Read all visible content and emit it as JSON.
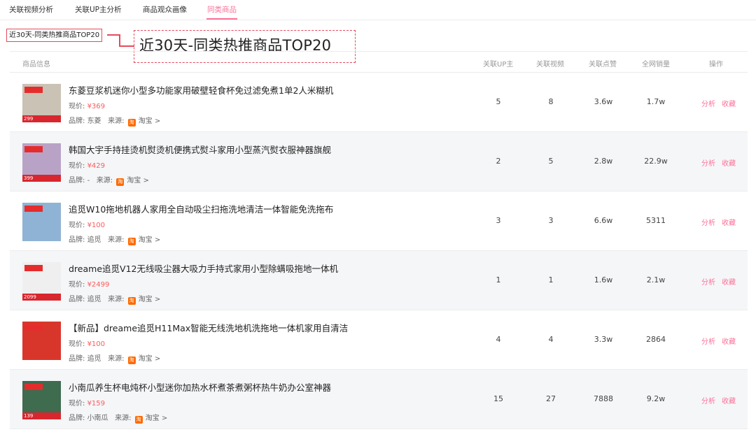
{
  "tabs": [
    "关联视频分析",
    "关联UP主分析",
    "商品观众画像",
    "同类商品"
  ],
  "active_tab": "同类商品",
  "section_title": "近30天-同类热推商品TOP20",
  "callout_text": "近30天-同类热推商品TOP20",
  "table": {
    "headers": [
      "商品信息",
      "关联UP主",
      "关联视频",
      "关联点赞",
      "全网销量",
      "操作"
    ],
    "price_label": "现价:",
    "brand_label": "品牌:",
    "source_label": "来源:",
    "action_analyze": "分析",
    "action_collect": "收藏",
    "rows": [
      {
        "title": "东菱豆浆机迷你小型多功能家用破壁轻食杯免过滤免煮1单2人米糊机",
        "price": "¥369",
        "brand": "东菱",
        "source": "淘宝 >",
        "thumb_price": "299",
        "thumb_color": "#c9c2b5",
        "up": "5",
        "videos": "8",
        "likes": "3.6w",
        "sales": "1.7w"
      },
      {
        "title": "韩国大宇手持挂烫机熨烫机便携式熨斗家用小型蒸汽熨衣服神器旗舰",
        "price": "¥429",
        "brand": "-",
        "source": "淘宝 >",
        "thumb_price": "399",
        "thumb_color": "#b8a3c6",
        "up": "2",
        "videos": "5",
        "likes": "2.8w",
        "sales": "22.9w"
      },
      {
        "title": "追觅W10拖地机器人家用全自动吸尘扫拖洗地清洁一体智能免洗拖布",
        "price": "¥100",
        "brand": "追觅",
        "source": "淘宝 >",
        "thumb_price": "",
        "thumb_color": "#8fb3d4",
        "up": "3",
        "videos": "3",
        "likes": "6.6w",
        "sales": "5311"
      },
      {
        "title": "dreame追觅V12无线吸尘器大吸力手持式家用小型除螨吸拖地一体机",
        "price": "¥2499",
        "brand": "追觅",
        "source": "淘宝 >",
        "thumb_price": "2099",
        "thumb_color": "#efefef",
        "up": "1",
        "videos": "1",
        "likes": "1.6w",
        "sales": "2.1w"
      },
      {
        "title": "【新品】dreame追觅H11Max智能无线洗地机洗拖地一体机家用自清洁",
        "price": "¥100",
        "brand": "追觅",
        "source": "淘宝 >",
        "thumb_price": "",
        "thumb_color": "#d9362b",
        "up": "4",
        "videos": "4",
        "likes": "3.3w",
        "sales": "2864"
      },
      {
        "title": "小南瓜养生杯电炖杯小型迷你加热水杯煮茶煮粥杯热牛奶办公室神器",
        "price": "¥159",
        "brand": "小南瓜",
        "source": "淘宝 >",
        "thumb_price": "139",
        "thumb_color": "#3f6b4f",
        "up": "15",
        "videos": "27",
        "likes": "7888",
        "sales": "9.2w"
      }
    ]
  },
  "colors": {
    "accent": "#fb7299",
    "annotation": "#e64a5c",
    "price": "#fb5c5c"
  }
}
